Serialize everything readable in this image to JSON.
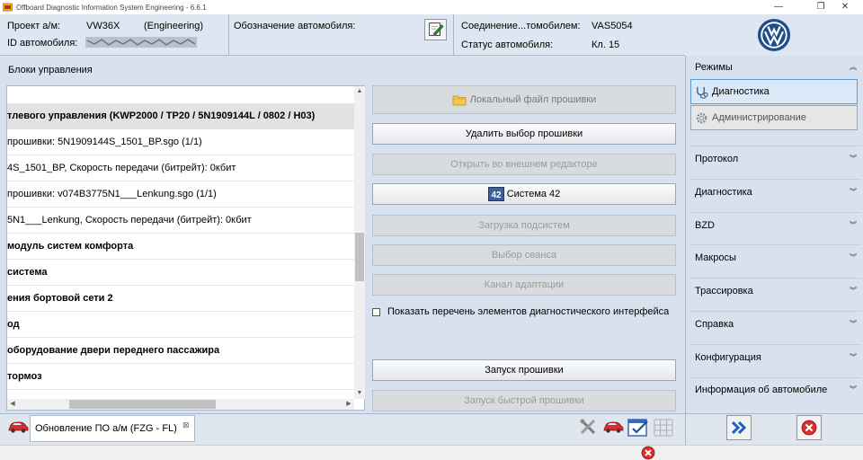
{
  "window": {
    "title": "Offboard Diagnostic Information System Engineering - 6.6.1",
    "minimize": "—",
    "restore": "❐",
    "close": "✕"
  },
  "header": {
    "project_label": "Проект а/м:",
    "project_value": "VW36X",
    "project_type": "(Engineering)",
    "vehicle_id_label": "ID автомобиля:",
    "designation_label": "Обозначение автомобиля:",
    "connection_label": "Соединение...томобилем:",
    "connection_value": "VAS5054",
    "status_label": "Статус автомобиля:",
    "status_value": "Кл. 15"
  },
  "main": {
    "blocks_label": "Блоки управления",
    "rows": [
      {
        "text": ""
      },
      {
        "text": "тлевого управления  (KWP2000 / TP20 / 5N1909144L / 0802 / H03)"
      },
      {
        "text": "прошивки: 5N1909144S_1501_BP.sgo (1/1)"
      },
      {
        "text": "4S_1501_BP, Скорость передачи (битрейт): 0кбит"
      },
      {
        "text": "прошивки: v074B3775N1___Lenkung.sgo (1/1)"
      },
      {
        "text": "5N1___Lenkung, Скорость передачи (битрейт): 0кбит"
      },
      {
        "text": "модуль систем комфорта"
      },
      {
        "text": "система"
      },
      {
        "text": "ения бортовой сети 2"
      },
      {
        "text": "од"
      },
      {
        "text": "оборудование двери переднего пассажира"
      },
      {
        "text": "тормоз"
      }
    ],
    "buttons": {
      "local_file": "Локальный файл прошивки",
      "delete_selection": "Удалить выбор прошивки",
      "open_external": "Открыть во внешнем редакторе",
      "system42": "Система 42",
      "load_subsystems": "Загрузка подсистем",
      "select_session": "Выбор сеанса",
      "adaptation_channel": "Канал адаптации",
      "start_flash": "Запуск прошивки",
      "start_quick_flash": "Запуск быстрой прошивки"
    },
    "show_interface_list_label": "Показать перечень элементов диагностического интерфейса",
    "system42_icon_text": "42"
  },
  "sidebar": {
    "modes_header": "Режимы",
    "mode_diagnostics": "Диагностика",
    "mode_admin": "Администрирование",
    "sections": [
      {
        "label": "Протокол"
      },
      {
        "label": "Диагностика"
      },
      {
        "label": "BZD"
      },
      {
        "label": "Макросы"
      },
      {
        "label": "Трассировка"
      },
      {
        "label": "Справка"
      },
      {
        "label": "Конфигурация"
      },
      {
        "label": "Информация об автомобиле"
      }
    ]
  },
  "bottom": {
    "tab_label": "Обновление ПО а/м (FZG - FL)",
    "tab_close": "⊠"
  },
  "colors": {
    "accent": "#5b9bd5",
    "panel": "#d8e2ee",
    "header": "#dde6f1",
    "error_red": "#d9302c"
  }
}
